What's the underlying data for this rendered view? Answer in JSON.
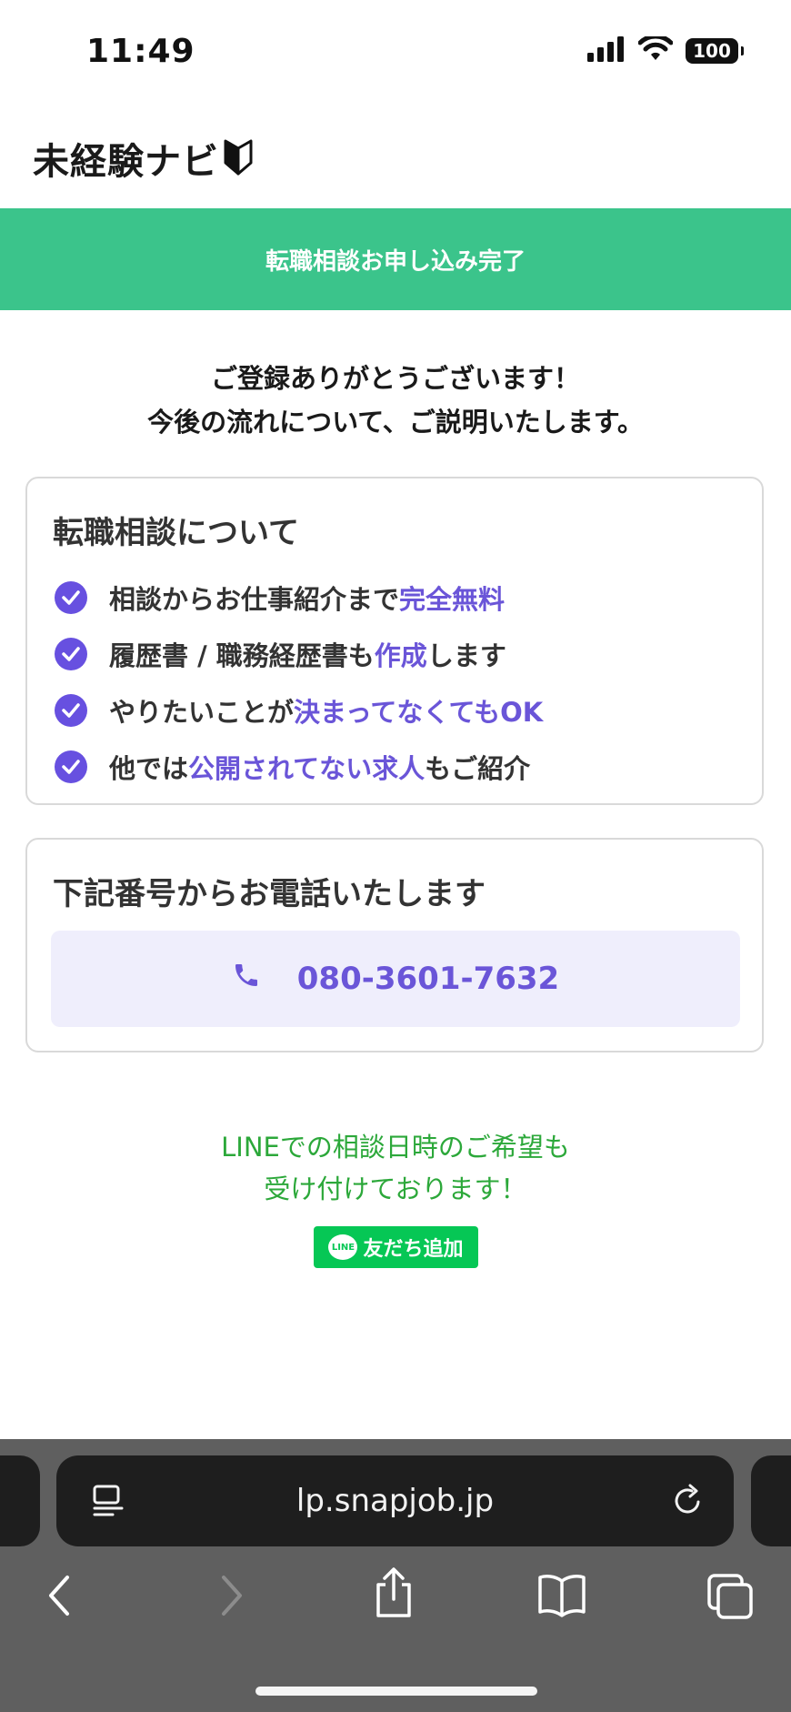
{
  "status_bar": {
    "time": "11:49",
    "battery": "100"
  },
  "header": {
    "logo_text": "未経験ナビ"
  },
  "banner": {
    "text": "転職相談お申し込み完了"
  },
  "intro": {
    "line1": "ご登録ありがとうございます！",
    "line2": "今後の流れについて、ご説明いたします。"
  },
  "features_card": {
    "title": "転職相談について",
    "items": [
      {
        "pre": "相談からお仕事紹介まで",
        "highlight": "完全無料",
        "post": ""
      },
      {
        "pre": "履歴書 / 職務経歴書も",
        "highlight": "作成",
        "post": "します"
      },
      {
        "pre": "やりたいことが",
        "highlight": "決まってなくてもOK",
        "post": ""
      },
      {
        "pre": "他では",
        "highlight": "公開されてない求人",
        "post": "もご紹介"
      }
    ]
  },
  "phone_card": {
    "title": "下記番号からお電話いたします",
    "number": "080-3601-7632"
  },
  "line_section": {
    "line1": "LINEでの相談日時のご希望も",
    "line2": "受け付けております！",
    "button_badge": "LINE",
    "button_label": "友だち追加"
  },
  "browser": {
    "url": "lp.snapjob.jp"
  },
  "colors": {
    "banner_green": "#3bc48b",
    "accent_purple": "#6a55d8",
    "line_green": "#06c755"
  },
  "icons": [
    "signal-icon",
    "wifi-icon",
    "battery-icon",
    "beginner-mark-icon",
    "check-icon",
    "phone-icon",
    "line-logo-icon",
    "reader-icon",
    "reload-icon",
    "back-icon",
    "forward-icon",
    "share-icon",
    "bookmarks-icon",
    "tabs-icon"
  ]
}
